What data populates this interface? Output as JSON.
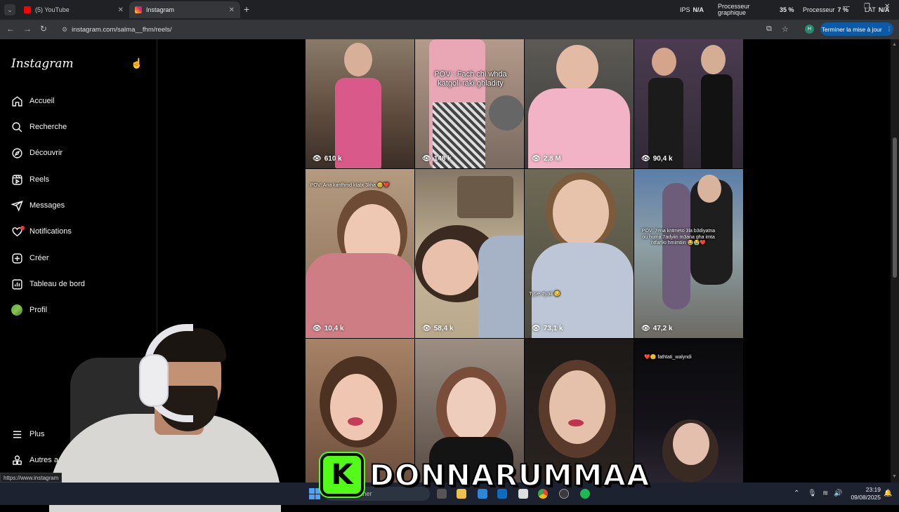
{
  "browser": {
    "tabs": [
      {
        "label": "(5) YouTube",
        "active": false,
        "icon": "youtube-icon"
      },
      {
        "label": "Instagram",
        "active": true,
        "icon": "instagram-icon"
      }
    ],
    "url": "instagram.com/salma__fhm/reels/",
    "update_button": "Terminer la mise à jour",
    "profile_initial": "H",
    "status_url": "https://www.instagram",
    "hud": {
      "ips_label": "IPS",
      "ips_value": "N/A",
      "gpu_label_1": "Processeur",
      "gpu_label_2": "graphique",
      "gpu_value": "35 %",
      "cpu_label": "Processeur",
      "cpu_value": "7 %",
      "lat_label": "LAT",
      "lat_value": "N/A"
    }
  },
  "sidebar": {
    "logo": "Instagram",
    "items": [
      {
        "label": "Accueil",
        "icon": "home-icon"
      },
      {
        "label": "Recherche",
        "icon": "search-icon"
      },
      {
        "label": "Découvrir",
        "icon": "compass-icon"
      },
      {
        "label": "Reels",
        "icon": "reels-icon"
      },
      {
        "label": "Messages",
        "icon": "send-icon"
      },
      {
        "label": "Notifications",
        "icon": "heart-icon"
      },
      {
        "label": "Créer",
        "icon": "plus-square-icon"
      },
      {
        "label": "Tableau de bord",
        "icon": "dashboard-icon"
      },
      {
        "label": "Profil",
        "icon": "avatar"
      },
      {
        "label": "Plus",
        "icon": "menu-icon"
      },
      {
        "label": "Autres a",
        "icon": "more-apps-icon"
      }
    ]
  },
  "reels": [
    {
      "views": "610 k",
      "caption": ""
    },
    {
      "views": "148 k",
      "caption": "POV : Fach chi whda katgoli raki ghladity"
    },
    {
      "views": "2,8 M",
      "caption": ""
    },
    {
      "views": "90,4 k",
      "caption": ""
    },
    {
      "views": "10,4 k",
      "caption": "POV: Ana kanfhmd ktabt 3liha 🥹❤️"
    },
    {
      "views": "58,4 k",
      "caption": ""
    },
    {
      "views": "73,1 k",
      "caption": "Type dyali 😏"
    },
    {
      "views": "47,2 k",
      "caption": "POV: 7ena kntmeto 3la b3diyatna ou huma 7adyiin m3ana gha imta ntfar9o hmimtiin 😂😭❤️"
    },
    {
      "views": "",
      "caption": ""
    },
    {
      "views": "",
      "caption": ""
    },
    {
      "views": "",
      "caption": ""
    },
    {
      "views": "",
      "caption": "❤️🙂 fathtati_walyndi"
    }
  ],
  "overlay": {
    "streamer_name": "DONNARUMMAA",
    "platform_letter": "K"
  },
  "taskbar": {
    "search_placeholder": "cher",
    "time": "23:19",
    "date": "09/08/2025"
  },
  "colors": {
    "kick_green": "#53fc18",
    "notification_red": "#ff3040",
    "update_blue": "#0b5aa7"
  }
}
